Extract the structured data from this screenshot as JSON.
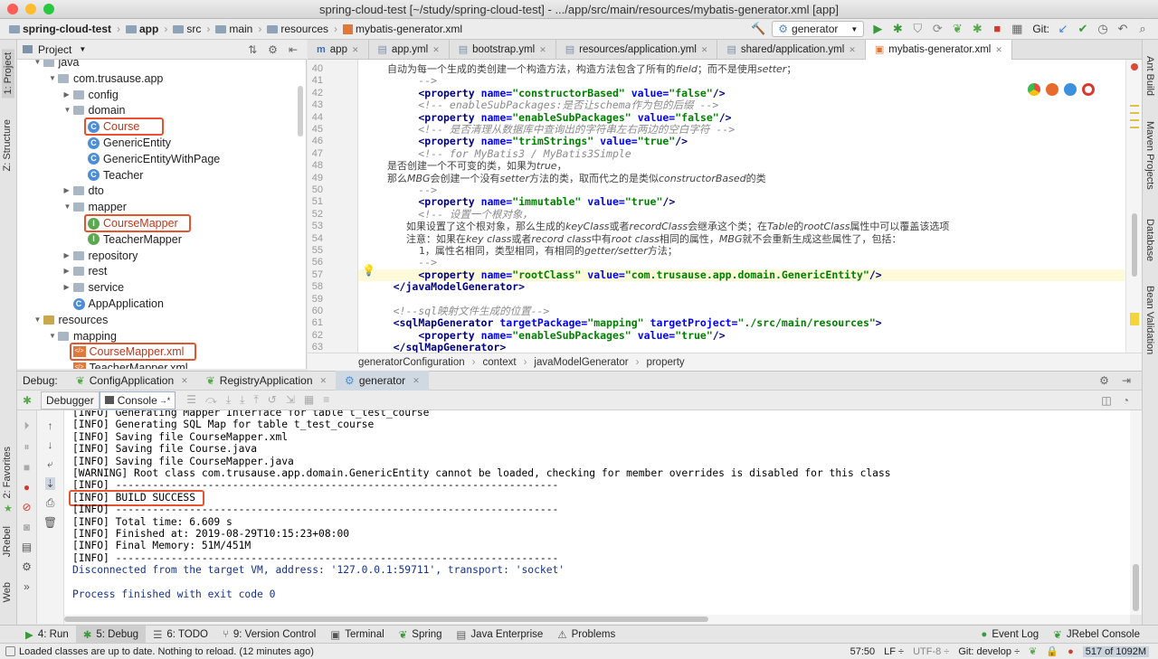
{
  "window": {
    "title": "spring-cloud-test [~/study/spring-cloud-test] - .../app/src/main/resources/mybatis-generator.xml [app]"
  },
  "breadcrumbs": [
    "spring-cloud-test",
    "app",
    "src",
    "main",
    "resources",
    "mybatis-generator.xml"
  ],
  "toolbar": {
    "run_config": "generator",
    "git_label": "Git:"
  },
  "left_strip": {
    "project": "1: Project",
    "structure": "Z: Structure",
    "favorites": "2: Favorites",
    "jrebel": "JRebel",
    "web": "Web"
  },
  "right_strip": {
    "ant": "Ant Build",
    "maven": "Maven Projects",
    "database": "Database",
    "bean": "Bean Validation"
  },
  "project": {
    "header": "Project",
    "tree": [
      {
        "label": "java",
        "kind": "folder",
        "depth": 1,
        "arrow": "▼"
      },
      {
        "label": "com.trusause.app",
        "kind": "folder",
        "depth": 2,
        "arrow": "▼"
      },
      {
        "label": "config",
        "kind": "folder",
        "depth": 3,
        "arrow": "▶"
      },
      {
        "label": "domain",
        "kind": "folder",
        "depth": 3,
        "arrow": "▼"
      },
      {
        "label": "Course",
        "kind": "class",
        "depth": 4,
        "arrow": ""
      },
      {
        "label": "GenericEntity",
        "kind": "class",
        "depth": 4,
        "arrow": ""
      },
      {
        "label": "GenericEntityWithPage",
        "kind": "class",
        "depth": 4,
        "arrow": ""
      },
      {
        "label": "Teacher",
        "kind": "class",
        "depth": 4,
        "arrow": ""
      },
      {
        "label": "dto",
        "kind": "folder",
        "depth": 3,
        "arrow": "▶"
      },
      {
        "label": "mapper",
        "kind": "folder",
        "depth": 3,
        "arrow": "▼"
      },
      {
        "label": "CourseMapper",
        "kind": "interface",
        "depth": 4,
        "arrow": ""
      },
      {
        "label": "TeacherMapper",
        "kind": "interface",
        "depth": 4,
        "arrow": ""
      },
      {
        "label": "repository",
        "kind": "folder",
        "depth": 3,
        "arrow": "▶"
      },
      {
        "label": "rest",
        "kind": "folder",
        "depth": 3,
        "arrow": "▶"
      },
      {
        "label": "service",
        "kind": "folder",
        "depth": 3,
        "arrow": "▶"
      },
      {
        "label": "AppApplication",
        "kind": "class",
        "depth": 3,
        "arrow": ""
      },
      {
        "label": "resources",
        "kind": "folder",
        "depth": 1,
        "arrow": "▼"
      },
      {
        "label": "mapping",
        "kind": "folder",
        "depth": 2,
        "arrow": "▼"
      },
      {
        "label": "CourseMapper.xml",
        "kind": "xml",
        "depth": 3,
        "arrow": ""
      },
      {
        "label": "TeacherMapper.xml",
        "kind": "xml",
        "depth": 3,
        "arrow": ""
      }
    ]
  },
  "editor": {
    "tabs": [
      {
        "label": "app",
        "icon": "m"
      },
      {
        "label": "app.yml",
        "icon": "y"
      },
      {
        "label": "bootstrap.yml",
        "icon": "y"
      },
      {
        "label": "resources/application.yml",
        "icon": "y"
      },
      {
        "label": "shared/application.yml",
        "icon": "y"
      },
      {
        "label": "mybatis-generator.xml",
        "icon": "x"
      }
    ],
    "lines": [
      {
        "n": "40",
        "html": "<span class=\"cn\">        自动为每一个生成的类创建一个构造方法，构造方法包含了所有的<i>field</i>；而不是使用<i>setter</i>；</span>"
      },
      {
        "n": "41",
        "html": "<span class=\"cmt\">         --></span>"
      },
      {
        "n": "42",
        "html": "         <span class=\"tag\">&lt;property</span> <span class=\"an\">name=</span><span class=\"av\">\"constructorBased\"</span> <span class=\"an\">value=</span><span class=\"av\">\"false\"</span><span class=\"tag\">/&gt;</span>"
      },
      {
        "n": "43",
        "html": "<span class=\"cmt\">         &lt;!-- enableSubPackages:是否让schema作为包的后缀 --&gt;</span>"
      },
      {
        "n": "44",
        "html": "         <span class=\"tag\">&lt;property</span> <span class=\"an\">name=</span><span class=\"av\">\"enableSubPackages\"</span> <span class=\"an\">value=</span><span class=\"av\">\"false\"</span><span class=\"tag\">/&gt;</span>"
      },
      {
        "n": "45",
        "html": "<span class=\"cmt\">         &lt;!-- 是否清理从数据库中查询出的字符串左右两边的空白字符 --&gt;</span>"
      },
      {
        "n": "46",
        "html": "         <span class=\"tag\">&lt;property</span> <span class=\"an\">name=</span><span class=\"av\">\"trimStrings\"</span> <span class=\"an\">value=</span><span class=\"av\">\"true\"</span><span class=\"tag\">/&gt;</span>"
      },
      {
        "n": "47",
        "html": "<span class=\"cmt\">         &lt;!-- for MyBatis3 / MyBatis3Simple</span>"
      },
      {
        "n": "48",
        "html": "<span class=\"cn\">        是否创建一个不可变的类，如果为<i>true</i>，</span>"
      },
      {
        "n": "49",
        "html": "<span class=\"cn\">        那么<i>MBG</i>会创建一个没有<i>setter</i>方法的类，取而代之的是类似<i>constructorBased</i>的类</span>"
      },
      {
        "n": "50",
        "html": "<span class=\"cmt\">         --></span>"
      },
      {
        "n": "51",
        "html": "         <span class=\"tag\">&lt;property</span> <span class=\"an\">name=</span><span class=\"av\">\"immutable\"</span> <span class=\"an\">value=</span><span class=\"av\">\"true\"</span><span class=\"tag\">/&gt;</span>"
      },
      {
        "n": "52",
        "html": "<span class=\"cmt\">         &lt;!-- 设置一个根对象，</span>"
      },
      {
        "n": "53",
        "html": "<span class=\"cn\">              如果设置了这个根对象，那么生成的<i>keyClass</i>或者<i>recordClass</i>会继承这个类；在<i>Table</i>的<i>rootClass</i>属性中可以覆盖该选项</span>"
      },
      {
        "n": "54",
        "html": "<span class=\"cn\">              注意：如果在<i>key class</i>或者<i>record class</i>中有<i>root class</i>相同的属性，<i>MBG</i>就不会重新生成这些属性了，包括：</span>"
      },
      {
        "n": "55",
        "html": "<span class=\"cn\">                  1，属性名相同，类型相同，有相同的<i>getter/setter</i>方法；</span>"
      },
      {
        "n": "56",
        "html": "<span class=\"cmt\">         --></span>"
      },
      {
        "n": "57",
        "html": "         <span class=\"tag\">&lt;property</span> <span class=\"an\">name=</span><span class=\"av\">\"rootClass\"</span> <span class=\"an\">value=</span><span class=\"av\">\"com.trusause.app.domain.GenericEntity\"</span><span class=\"tag\">/&gt;</span>"
      },
      {
        "n": "58",
        "html": "     <span class=\"tag\">&lt;/javaModelGenerator&gt;</span>"
      },
      {
        "n": "59",
        "html": ""
      },
      {
        "n": "60",
        "html": "<span class=\"cmt\">     &lt;!--sql映射文件生成的位置--&gt;</span>"
      },
      {
        "n": "61",
        "html": "     <span class=\"tag\">&lt;sqlMapGenerator</span> <span class=\"an\">targetPackage=</span><span class=\"av\">\"mapping\"</span> <span class=\"an\">targetProject=</span><span class=\"av\">\"./src/main/resources\"</span><span class=\"tag\">&gt;</span>"
      },
      {
        "n": "62",
        "html": "         <span class=\"tag\">&lt;property</span> <span class=\"an\">name=</span><span class=\"av\">\"enableSubPackages\"</span> <span class=\"an\">value=</span><span class=\"av\">\"true\"</span><span class=\"tag\">/&gt;</span>"
      },
      {
        "n": "63",
        "html": "     <span class=\"tag\">&lt;/sqlMapGenerator&gt;</span>"
      }
    ],
    "breadcrumb": [
      "generatorConfiguration",
      "context",
      "javaModelGenerator",
      "property"
    ]
  },
  "debug": {
    "label": "Debug:",
    "tabs": [
      "ConfigApplication",
      "RegistryApplication",
      "generator"
    ],
    "subtabs": {
      "debugger": "Debugger",
      "console": "Console"
    },
    "console_lines": [
      {
        "text": "[INFO] Generating Mapper Interface for table t_test_course",
        "cls": ""
      },
      {
        "text": "[INFO] Generating SQL Map for table t_test_course",
        "cls": ""
      },
      {
        "text": "[INFO] Saving file CourseMapper.xml",
        "cls": ""
      },
      {
        "text": "[INFO] Saving file Course.java",
        "cls": ""
      },
      {
        "text": "[INFO] Saving file CourseMapper.java",
        "cls": ""
      },
      {
        "text": "[WARNING] Root class com.trusause.app.domain.GenericEntity cannot be loaded, checking for member overrides is disabled for this class",
        "cls": ""
      },
      {
        "text": "[INFO] ------------------------------------------------------------------------",
        "cls": ""
      },
      {
        "text": "[INFO] BUILD SUCCESS",
        "cls": ""
      },
      {
        "text": "[INFO] ------------------------------------------------------------------------",
        "cls": ""
      },
      {
        "text": "[INFO] Total time: 6.609 s",
        "cls": ""
      },
      {
        "text": "[INFO] Finished at: 2019-08-29T10:15:23+08:00",
        "cls": ""
      },
      {
        "text": "[INFO] Final Memory: 51M/451M",
        "cls": ""
      },
      {
        "text": "[INFO] ------------------------------------------------------------------------",
        "cls": ""
      },
      {
        "text": "Disconnected from the target VM, address: '127.0.0.1:59711', transport: 'socket'",
        "cls": "blue"
      },
      {
        "text": "",
        "cls": ""
      },
      {
        "text": "Process finished with exit code 0",
        "cls": "blue"
      }
    ]
  },
  "bottom_tools": [
    {
      "label": "4: Run",
      "icon": "▶"
    },
    {
      "label": "5: Debug",
      "icon": "✱"
    },
    {
      "label": "6: TODO",
      "icon": "☰"
    },
    {
      "label": "9: Version Control",
      "icon": "⑂"
    },
    {
      "label": "Terminal",
      "icon": "▣"
    },
    {
      "label": "Spring",
      "icon": "❦"
    },
    {
      "label": "Java Enterprise",
      "icon": "▤"
    },
    {
      "label": "Problems",
      "icon": "⚠"
    }
  ],
  "bottom_right_tools": [
    {
      "label": "Event Log",
      "icon": "●"
    },
    {
      "label": "JRebel Console",
      "icon": "❦"
    }
  ],
  "status": {
    "message": "Loaded classes are up to date. Nothing to reload. (12 minutes ago)",
    "position": "57:50",
    "line_sep": "LF ÷",
    "encoding": "UTF-8 ÷",
    "git": "Git: develop ÷",
    "memory": "517 of 1092M"
  },
  "colors": {
    "highlight": "#e4542f",
    "accent": "#4d8dd6"
  }
}
